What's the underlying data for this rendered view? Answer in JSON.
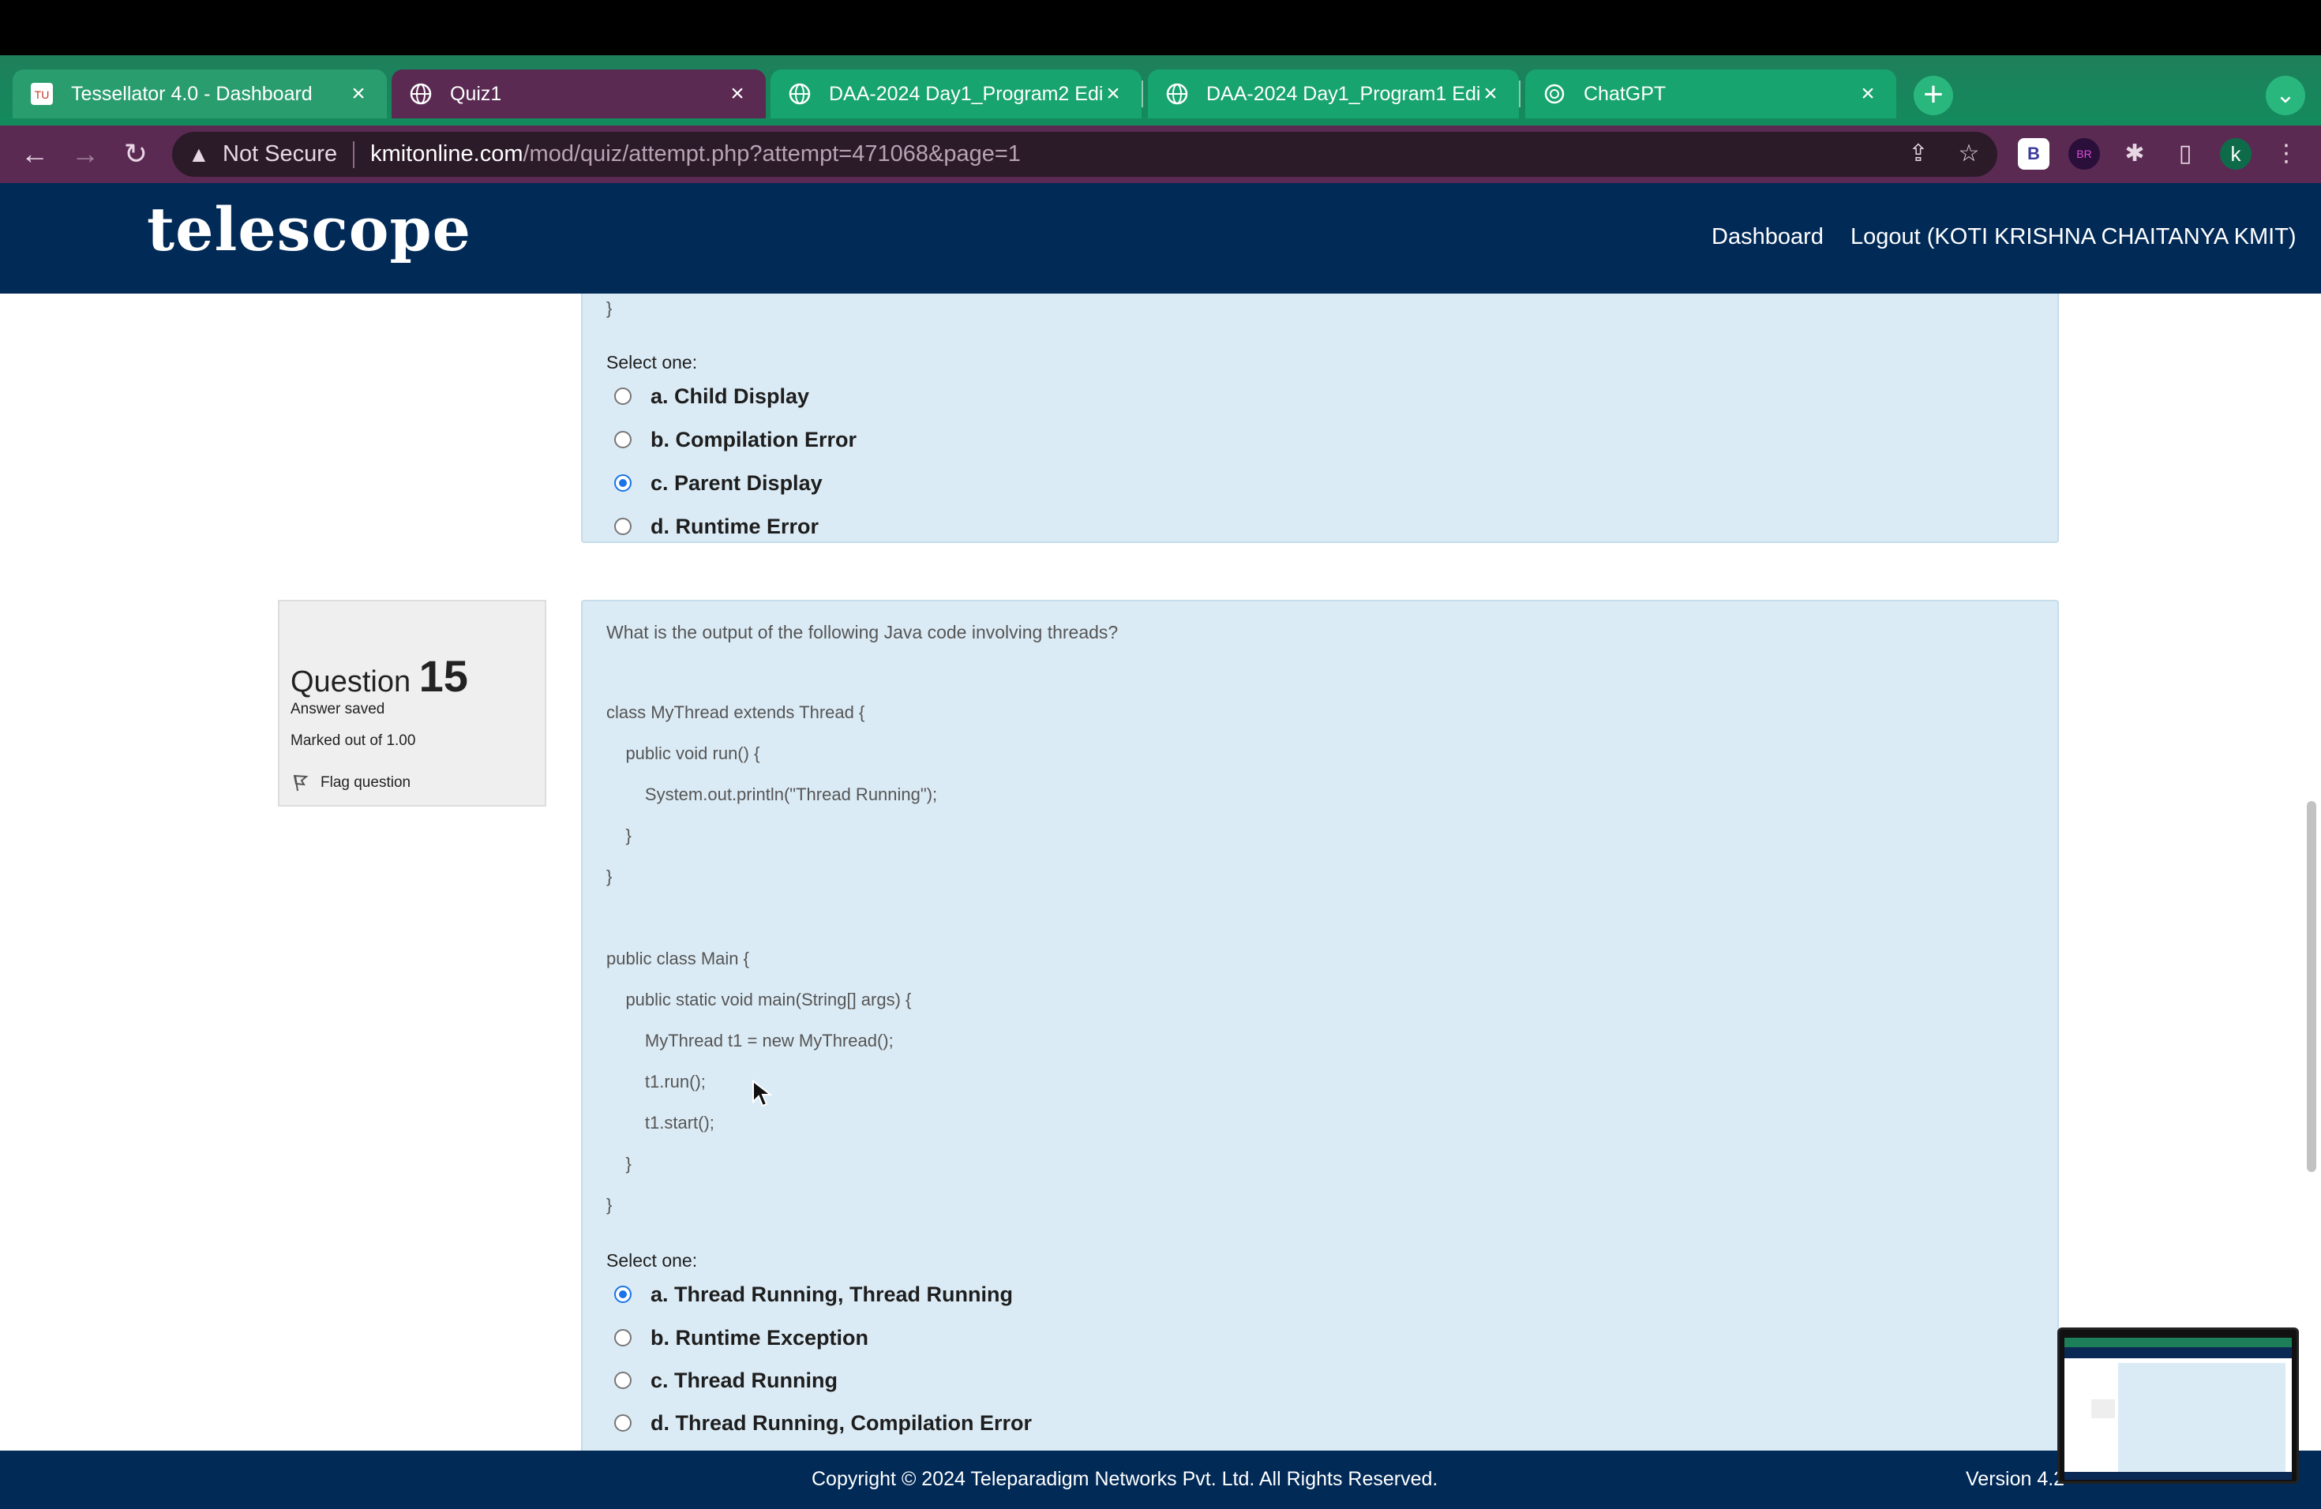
{
  "browser": {
    "tabs": [
      {
        "title": "Tessellator 4.0 - Dashboard",
        "icon": "tessellator-favicon-icon",
        "state": "inactive"
      },
      {
        "title": "Quiz1",
        "icon": "globe-icon",
        "state": "active"
      },
      {
        "title": "DAA-2024 Day1_Program2 Edi",
        "icon": "globe-icon",
        "state": "inactive"
      },
      {
        "title": "DAA-2024 Day1_Program1 Edi",
        "icon": "globe-icon",
        "state": "inactive"
      },
      {
        "title": "ChatGPT",
        "icon": "chatgpt-icon",
        "state": "inactive"
      }
    ],
    "new_tab": "+",
    "security_label": "Not Secure",
    "url_host": "kmitonline.com",
    "url_path": "/mod/quiz/attempt.php?attempt=471068&page=1",
    "profile_initial": "k",
    "extensions": [
      {
        "name": "b-extension-icon",
        "label": "B"
      },
      {
        "name": "br-extension-icon",
        "label": "BR"
      }
    ]
  },
  "site": {
    "logo": "telescope",
    "nav": {
      "dashboard": "Dashboard",
      "logout": "Logout (KOTI KRISHNA CHAITANYA KMIT)"
    }
  },
  "prev_question": {
    "code_tail": "}",
    "select_label": "Select one:",
    "options": [
      {
        "label": "a. Child Display",
        "selected": false
      },
      {
        "label": "b. Compilation Error",
        "selected": false
      },
      {
        "label": "c. Parent Display",
        "selected": true
      },
      {
        "label": "d. Runtime Error",
        "selected": false
      }
    ]
  },
  "question": {
    "word": "Question",
    "number": "15",
    "status": "Answer saved",
    "marks": "Marked out of 1.00",
    "flag_label": "Flag question",
    "text": "What is the output of the following Java code involving threads?",
    "code": [
      "class MyThread extends Thread {",
      "    public void run() {",
      "        System.out.println(\"Thread Running\");",
      "    }",
      "}",
      "",
      "public class Main {",
      "    public static void main(String[] args) {",
      "        MyThread t1 = new MyThread();",
      "        t1.run();",
      "        t1.start();",
      "    }",
      "}"
    ],
    "select_label": "Select one:",
    "options": [
      {
        "label": "a. Thread Running, Thread Running",
        "selected": true
      },
      {
        "label": "b. Runtime Exception",
        "selected": false
      },
      {
        "label": "c. Thread Running",
        "selected": false
      },
      {
        "label": "d. Thread Running, Compilation Error",
        "selected": false
      }
    ]
  },
  "footer": {
    "copyright": "Copyright © 2024 Teleparadigm Networks Pvt. Ltd. All Rights Reserved.",
    "version": "Version 4.2"
  },
  "colors": {
    "header_bg": "#012a57",
    "question_bg": "#dbebf5",
    "tab_strip": "#1f7f5b",
    "active_tab": "#5a2a52",
    "radio_selected": "#1a73e8"
  }
}
